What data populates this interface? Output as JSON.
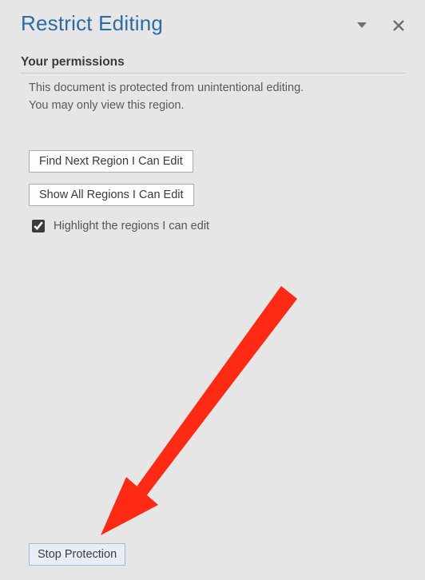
{
  "header": {
    "title": "Restrict Editing"
  },
  "permissions": {
    "heading": "Your permissions",
    "line1": "This document is protected from unintentional editing.",
    "line2": "You may only view this region."
  },
  "actions": {
    "find_next_label": "Find Next Region I Can Edit",
    "show_all_label": "Show All Regions I Can Edit",
    "highlight_label": "Highlight the regions I can edit",
    "highlight_checked": true
  },
  "footer": {
    "stop_label": "Stop Protection"
  },
  "annotation": {
    "arrow_color": "#ff2a13"
  }
}
